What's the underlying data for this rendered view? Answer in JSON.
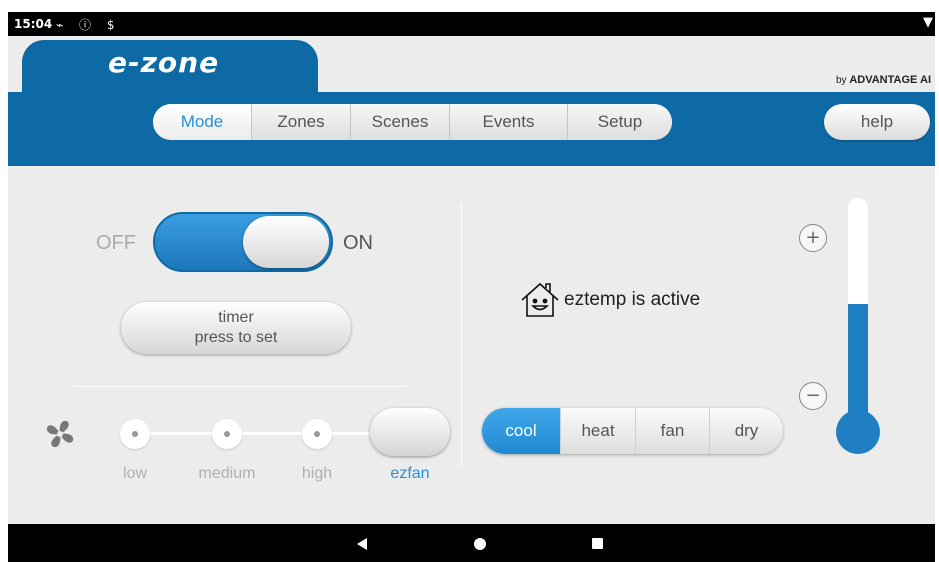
{
  "status_bar": {
    "time": "15:04",
    "icons": "⌁ ⓘ $",
    "right_icon": "▼"
  },
  "brand": {
    "name": "e-zone",
    "byline_prefix": "by",
    "byline_company": "ADVANTAGE AI"
  },
  "nav": {
    "tabs": [
      {
        "label": "Mode",
        "active": true
      },
      {
        "label": "Zones",
        "active": false
      },
      {
        "label": "Scenes",
        "active": false
      },
      {
        "label": "Events",
        "active": false
      },
      {
        "label": "Setup",
        "active": false
      }
    ],
    "help_label": "help"
  },
  "power": {
    "off_label": "OFF",
    "on_label": "ON",
    "state": "on"
  },
  "timer": {
    "line1": "timer",
    "line2": "press to set"
  },
  "fan": {
    "options": [
      {
        "label": "low",
        "active": false
      },
      {
        "label": "medium",
        "active": false
      },
      {
        "label": "high",
        "active": false
      },
      {
        "label": "ezfan",
        "active": true
      }
    ]
  },
  "eztemp": {
    "text": "eztemp is active"
  },
  "modes": [
    {
      "label": "cool",
      "active": true
    },
    {
      "label": "heat",
      "active": false
    },
    {
      "label": "fan",
      "active": false
    },
    {
      "label": "dry",
      "active": false
    }
  ],
  "temperature": {
    "plus_label": "+",
    "minus_label": "−",
    "level_fraction": 0.55
  },
  "colors": {
    "brand_blue": "#0e6aa5",
    "accent_blue": "#2a8fd4",
    "active_fill": "#1f7fc2"
  },
  "android_nav": {
    "back_icon": "back-icon",
    "home_icon": "home-icon",
    "recent_icon": "recent-apps-icon"
  }
}
